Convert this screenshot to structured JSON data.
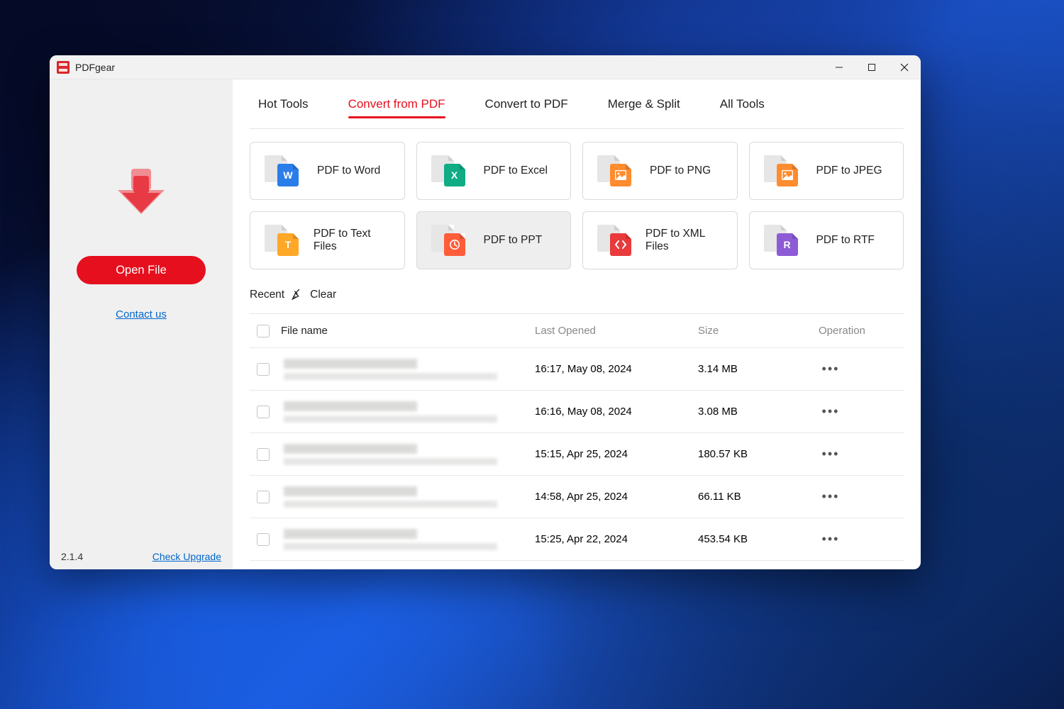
{
  "titlebar": {
    "app_name": "PDFgear"
  },
  "sidebar": {
    "open_file_label": "Open File",
    "contact_label": "Contact us",
    "version": "2.1.4",
    "upgrade_label": "Check Upgrade"
  },
  "tabs": [
    {
      "label": "Hot Tools",
      "active": false
    },
    {
      "label": "Convert from PDF",
      "active": true
    },
    {
      "label": "Convert to PDF",
      "active": false
    },
    {
      "label": "Merge & Split",
      "active": false
    },
    {
      "label": "All Tools",
      "active": false
    }
  ],
  "tools": [
    {
      "label": "PDF to Word",
      "color": "#2b7de9",
      "glyph": "W",
      "hovered": false
    },
    {
      "label": "PDF to Excel",
      "color": "#10ac84",
      "glyph": "X",
      "hovered": false
    },
    {
      "label": "PDF to PNG",
      "color": "#ff8c2e",
      "glyph": "img",
      "hovered": false
    },
    {
      "label": "PDF to JPEG",
      "color": "#ff8c2e",
      "glyph": "img",
      "hovered": false
    },
    {
      "label": "PDF to Text Files",
      "color": "#ffa726",
      "glyph": "T",
      "hovered": false
    },
    {
      "label": "PDF to PPT",
      "color": "#ff5d3a",
      "glyph": "clock",
      "hovered": true
    },
    {
      "label": "PDF to XML Files",
      "color": "#e93b3b",
      "glyph": "code",
      "hovered": false
    },
    {
      "label": "PDF to RTF",
      "color": "#8e5bd6",
      "glyph": "R",
      "hovered": false
    }
  ],
  "recent_bar": {
    "recent_label": "Recent",
    "clear_label": "Clear"
  },
  "table": {
    "headers": {
      "name": "File name",
      "opened": "Last Opened",
      "size": "Size",
      "operation": "Operation"
    },
    "rows": [
      {
        "opened": "16:17, May 08, 2024",
        "size": "3.14 MB"
      },
      {
        "opened": "16:16, May 08, 2024",
        "size": "3.08 MB"
      },
      {
        "opened": "15:15, Apr 25, 2024",
        "size": "180.57 KB"
      },
      {
        "opened": "14:58, Apr 25, 2024",
        "size": "66.11 KB"
      },
      {
        "opened": "15:25, Apr 22, 2024",
        "size": "453.54 KB"
      }
    ]
  }
}
